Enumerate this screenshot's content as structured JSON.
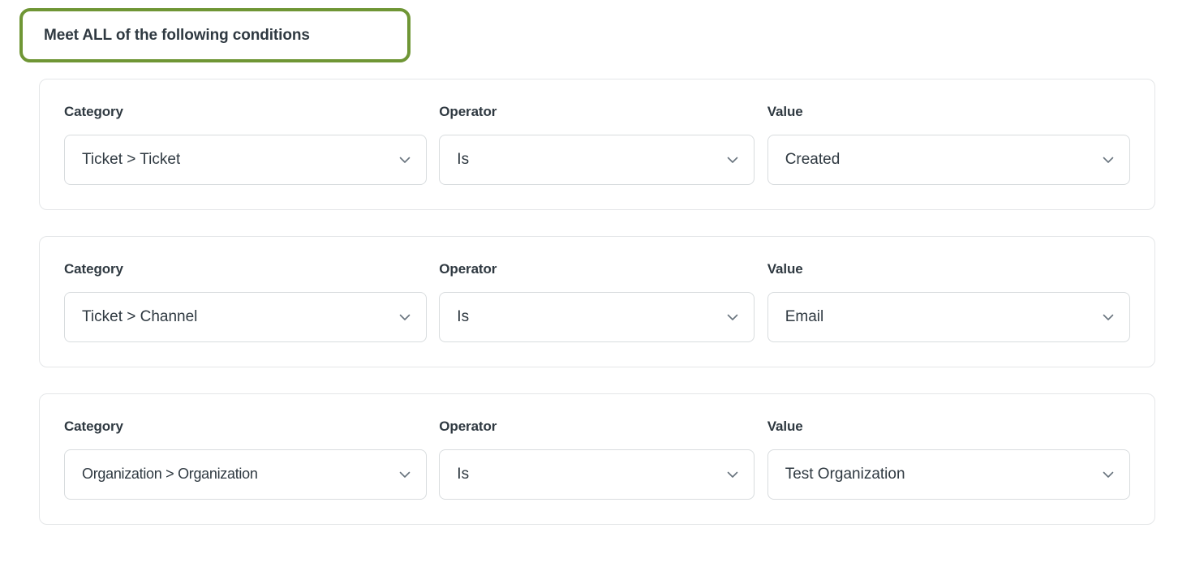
{
  "header": {
    "title": "Meet ALL of the following conditions",
    "highlight_color": "#6f9635"
  },
  "labels": {
    "category": "Category",
    "operator": "Operator",
    "value": "Value"
  },
  "icons": {
    "chevron_down": "chevron-down-icon"
  },
  "colors": {
    "text": "#2f3941",
    "border": "#d8dcde",
    "card_border": "#e4e6e8",
    "highlight": "#6f9635",
    "background": "#ffffff"
  },
  "conditions": [
    {
      "category_label": "Category",
      "operator_label": "Operator",
      "value_label": "Value",
      "category": "Ticket > Ticket",
      "operator": "Is",
      "value": "Created"
    },
    {
      "category_label": "Category",
      "operator_label": "Operator",
      "value_label": "Value",
      "category": "Ticket > Channel",
      "operator": "Is",
      "value": "Email"
    },
    {
      "category_label": "Category",
      "operator_label": "Operator",
      "value_label": "Value",
      "category": "Organization > Organization",
      "operator": "Is",
      "value": "Test Organization"
    }
  ]
}
